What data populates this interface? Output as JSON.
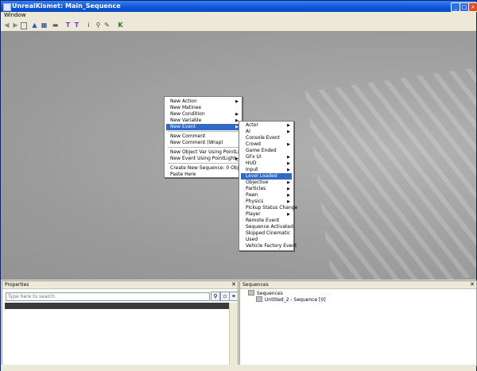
{
  "window": {
    "title": "UnrealKismet: Main_Sequence"
  },
  "menubar": {
    "items": [
      "Window"
    ]
  },
  "context_menu": {
    "items": [
      {
        "label": "New Action",
        "submenu": true
      },
      {
        "label": "New Matinee",
        "submenu": false
      },
      {
        "label": "New Condition",
        "submenu": true
      },
      {
        "label": "New Variable",
        "submenu": true
      },
      {
        "label": "New Event",
        "submenu": true
      },
      {
        "label": "New Comment",
        "submenu": false
      },
      {
        "label": "New Comment (Wrap)",
        "submenu": false
      },
      {
        "label": "New Object Var Using PointLight_0",
        "submenu": false
      },
      {
        "label": "New Event Using PointLight_0",
        "submenu": true
      },
      {
        "label": "Create New Sequence: 0 Objs",
        "submenu": false
      },
      {
        "label": "Paste Here",
        "submenu": false
      }
    ],
    "highlighted": "New Event"
  },
  "event_submenu": {
    "items": [
      {
        "label": "Actor",
        "submenu": true
      },
      {
        "label": "AI",
        "submenu": true
      },
      {
        "label": "Console Event",
        "submenu": false
      },
      {
        "label": "Crowd",
        "submenu": true
      },
      {
        "label": "Game Ended",
        "submenu": false
      },
      {
        "label": "GFx UI",
        "submenu": true
      },
      {
        "label": "HUD",
        "submenu": true
      },
      {
        "label": "Input",
        "submenu": true
      },
      {
        "label": "Level Loaded",
        "submenu": false
      },
      {
        "label": "Objective",
        "submenu": true
      },
      {
        "label": "Particles",
        "submenu": true
      },
      {
        "label": "Pawn",
        "submenu": true
      },
      {
        "label": "Physics",
        "submenu": true
      },
      {
        "label": "Pickup Status Change",
        "submenu": false
      },
      {
        "label": "Player",
        "submenu": true
      },
      {
        "label": "Remote Event",
        "submenu": false
      },
      {
        "label": "Sequence Activated",
        "submenu": false
      },
      {
        "label": "Skipped Cinematic",
        "submenu": false
      },
      {
        "label": "Used",
        "submenu": false
      },
      {
        "label": "Vehicle Factory Event",
        "submenu": false
      }
    ],
    "highlighted": "Level Loaded"
  },
  "properties": {
    "title": "Properties",
    "search_placeholder": "Type here to search"
  },
  "sequences": {
    "title": "Sequences",
    "root": "Sequences",
    "child": "Untitled_2 - Sequence [0]"
  },
  "glyphs": {
    "close": "✕",
    "arrow": "▶"
  }
}
